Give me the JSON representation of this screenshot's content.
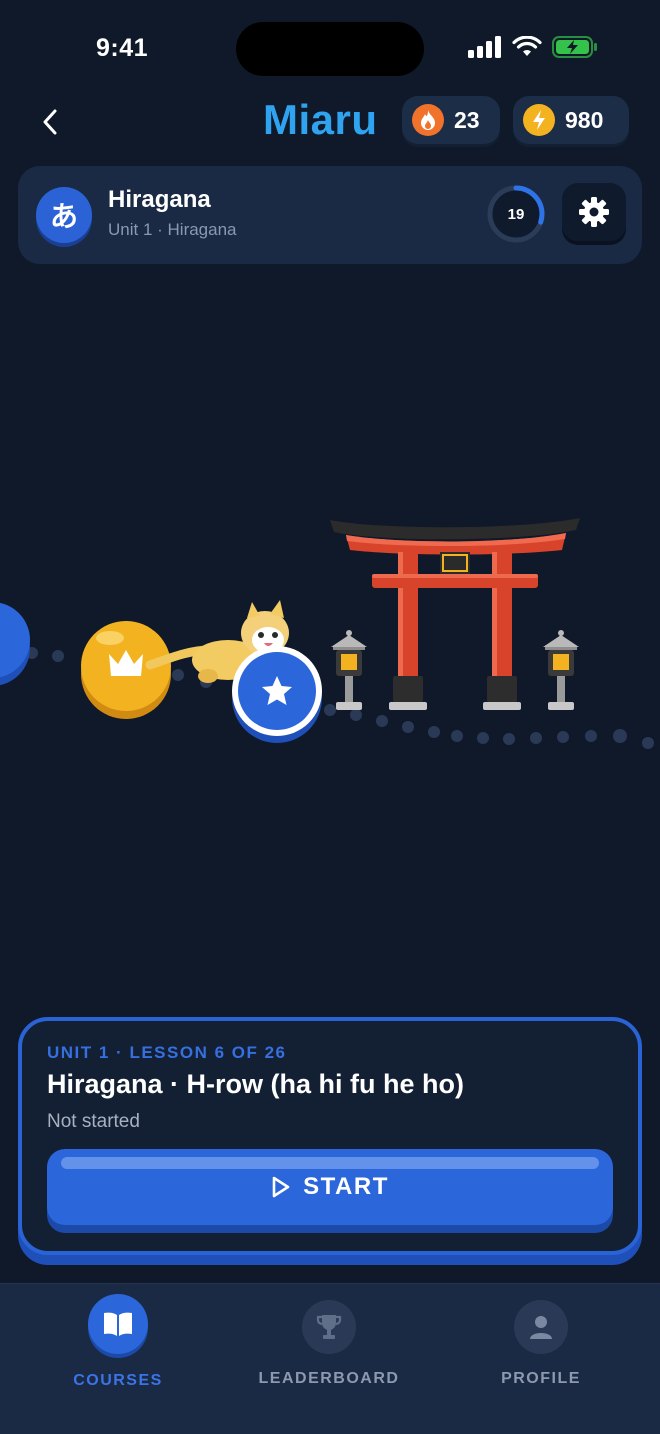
{
  "status_bar": {
    "time": "9:41"
  },
  "header": {
    "logo": "Miaru",
    "streak": {
      "value": "23",
      "icon": "fire-icon"
    },
    "energy": {
      "value": "980",
      "icon": "lightning-icon"
    }
  },
  "course": {
    "badge": "あ",
    "title": "Hiragana",
    "subtitle": "Unit 1 · Hiragana",
    "progress_count": "19",
    "progress_fraction": 0.3
  },
  "lesson": {
    "eyebrow": "UNIT 1 · LESSON 6 OF 26",
    "title": "Hiragana · H-row (ha hi fu he ho)",
    "status": "Not started",
    "start_label": "START"
  },
  "nav": {
    "items": [
      {
        "label": "COURSES",
        "icon": "book-icon",
        "active": true
      },
      {
        "label": "LEADERBOARD",
        "icon": "trophy-icon",
        "active": false
      },
      {
        "label": "PROFILE",
        "icon": "person-icon",
        "active": false
      }
    ]
  },
  "colors": {
    "background": "#0f1929",
    "accent": "#2b66db",
    "gold": "#f3b21f",
    "torii_red": "#d8432b"
  }
}
